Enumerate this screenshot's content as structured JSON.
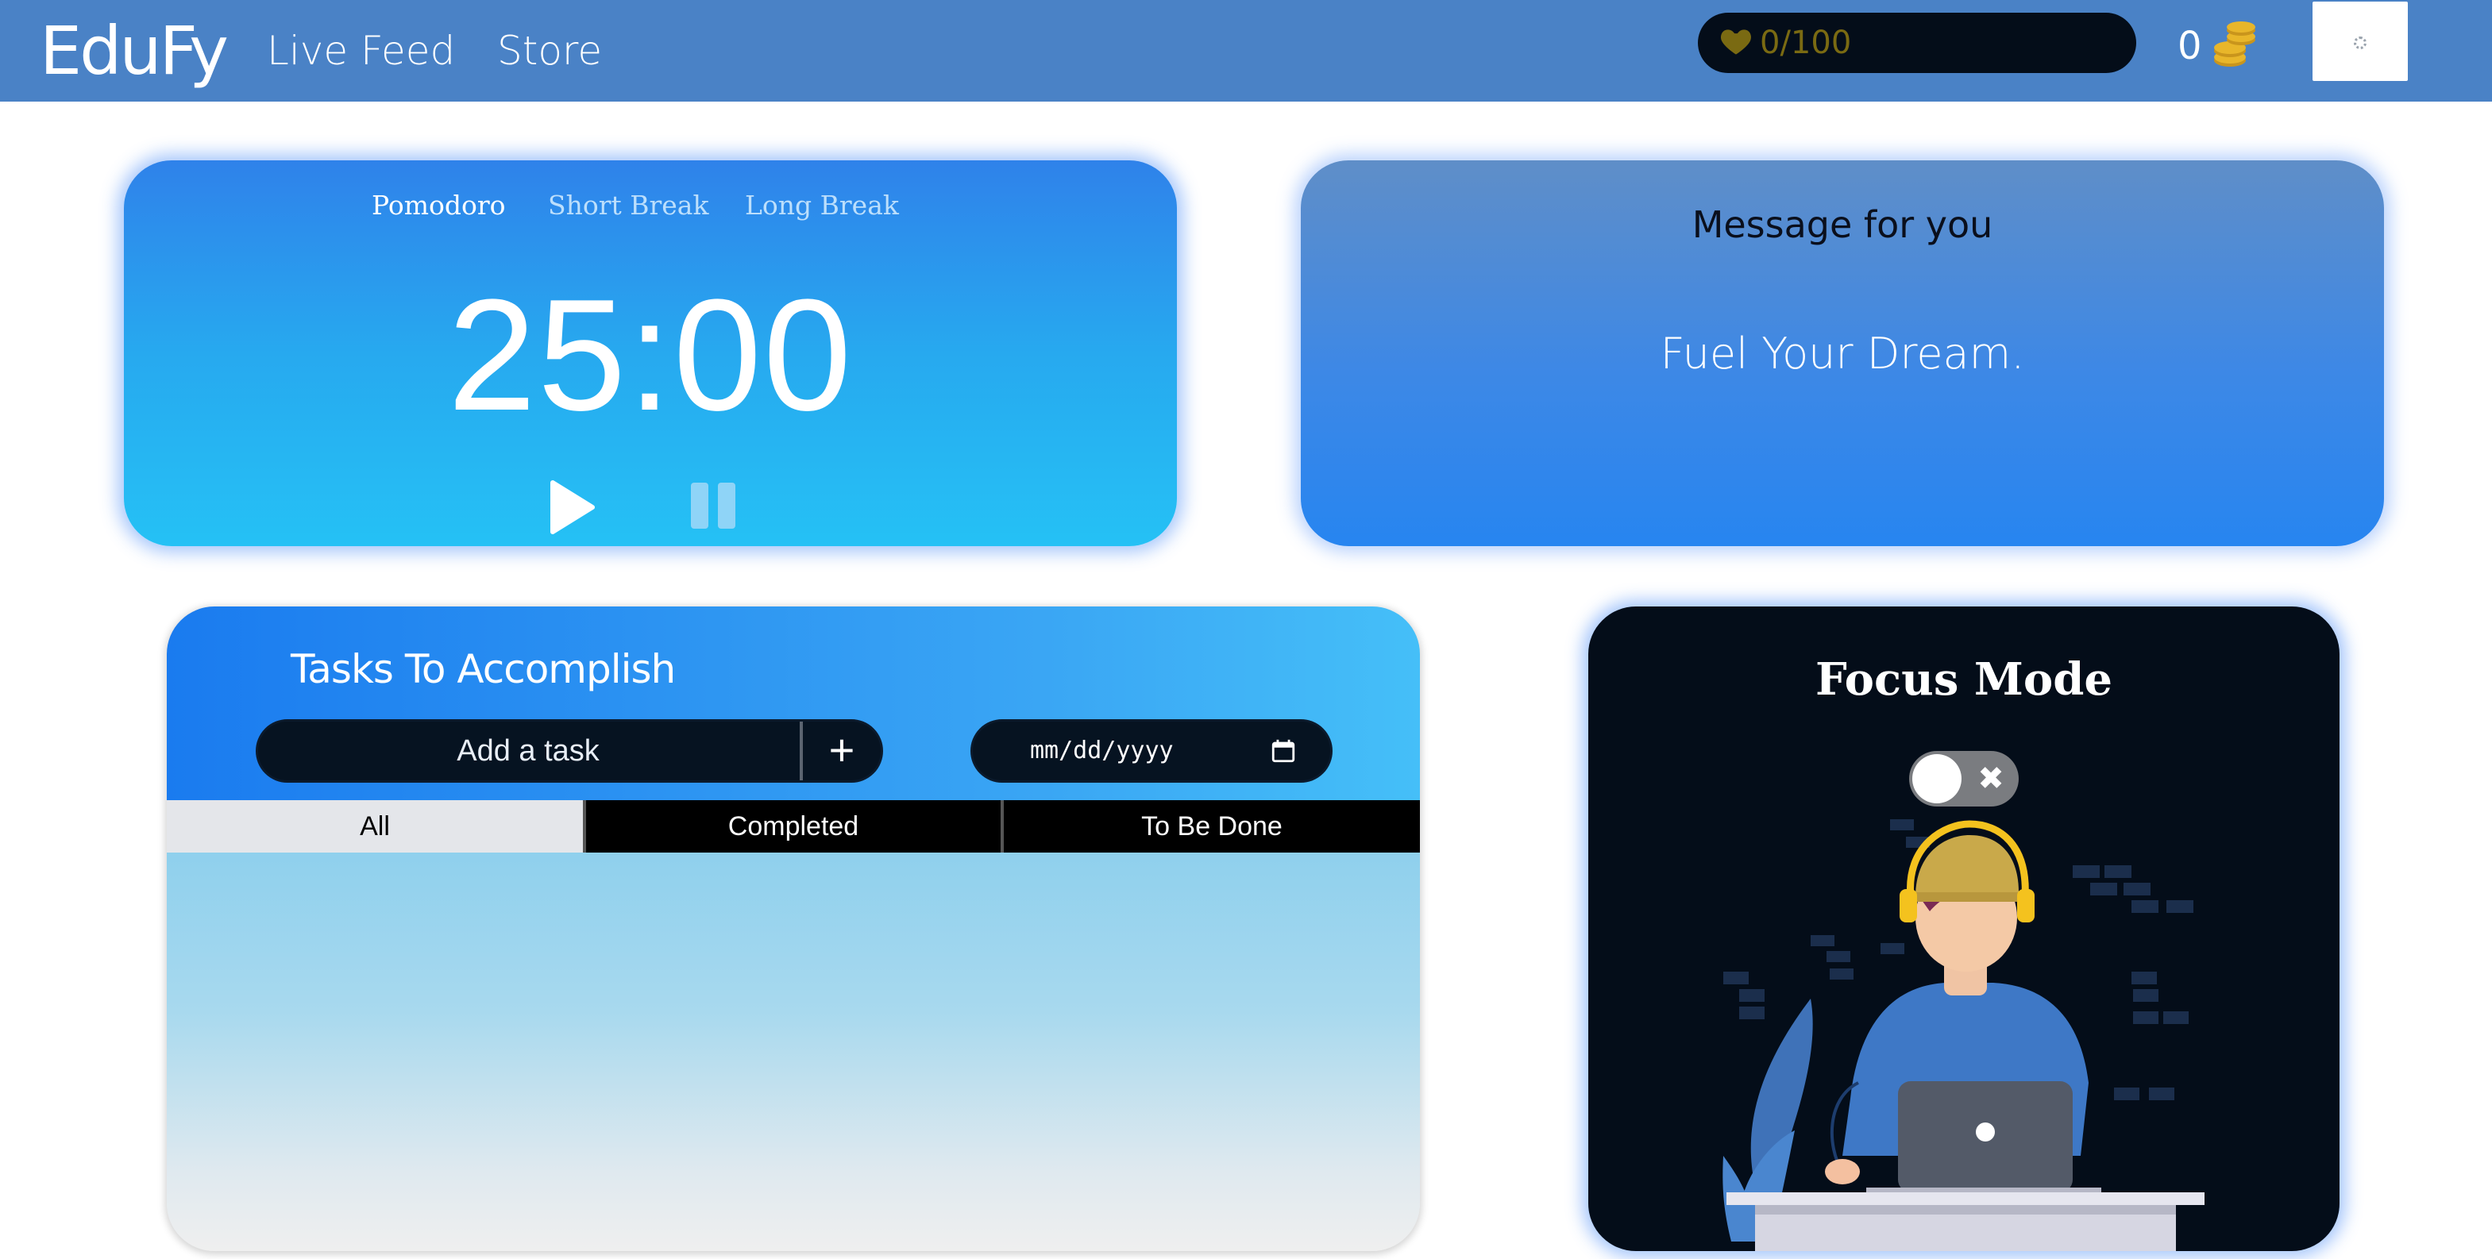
{
  "navbar": {
    "brand": "EduFy",
    "links": [
      "Live Feed",
      "Store"
    ],
    "health_text": "0/100",
    "health_icon": "heart-icon",
    "coins": "0",
    "coins_icon": "coins-icon",
    "avatar_icon": "loading-spinner-icon",
    "colors": {
      "bar": "#4a82c6",
      "health_bg": "#040d19",
      "health_text": "#7a6a12",
      "coin": "#e8b62a"
    }
  },
  "pomodoro": {
    "tabs": [
      "Pomodoro",
      "Short Break",
      "Long Break"
    ],
    "active_tab": "Pomodoro",
    "time": "25:00",
    "play_icon": "play-icon",
    "pause_icon": "pause-icon"
  },
  "message": {
    "title": "Message for you",
    "body": "Fuel Your Dream."
  },
  "tasks": {
    "title": "Tasks To Accomplish",
    "input_placeholder": "Add a task",
    "add_label": "+",
    "date_placeholder": "mm/dd/yyyy",
    "calendar_icon": "calendar-icon",
    "filters": [
      "All",
      "Completed",
      "To Be Done"
    ],
    "active_filter": "All",
    "items": []
  },
  "focus": {
    "title": "Focus Mode",
    "toggle_on": false,
    "toggle_off_symbol": "✖",
    "illustration": "person-with-headphones-at-laptop-illustration"
  }
}
